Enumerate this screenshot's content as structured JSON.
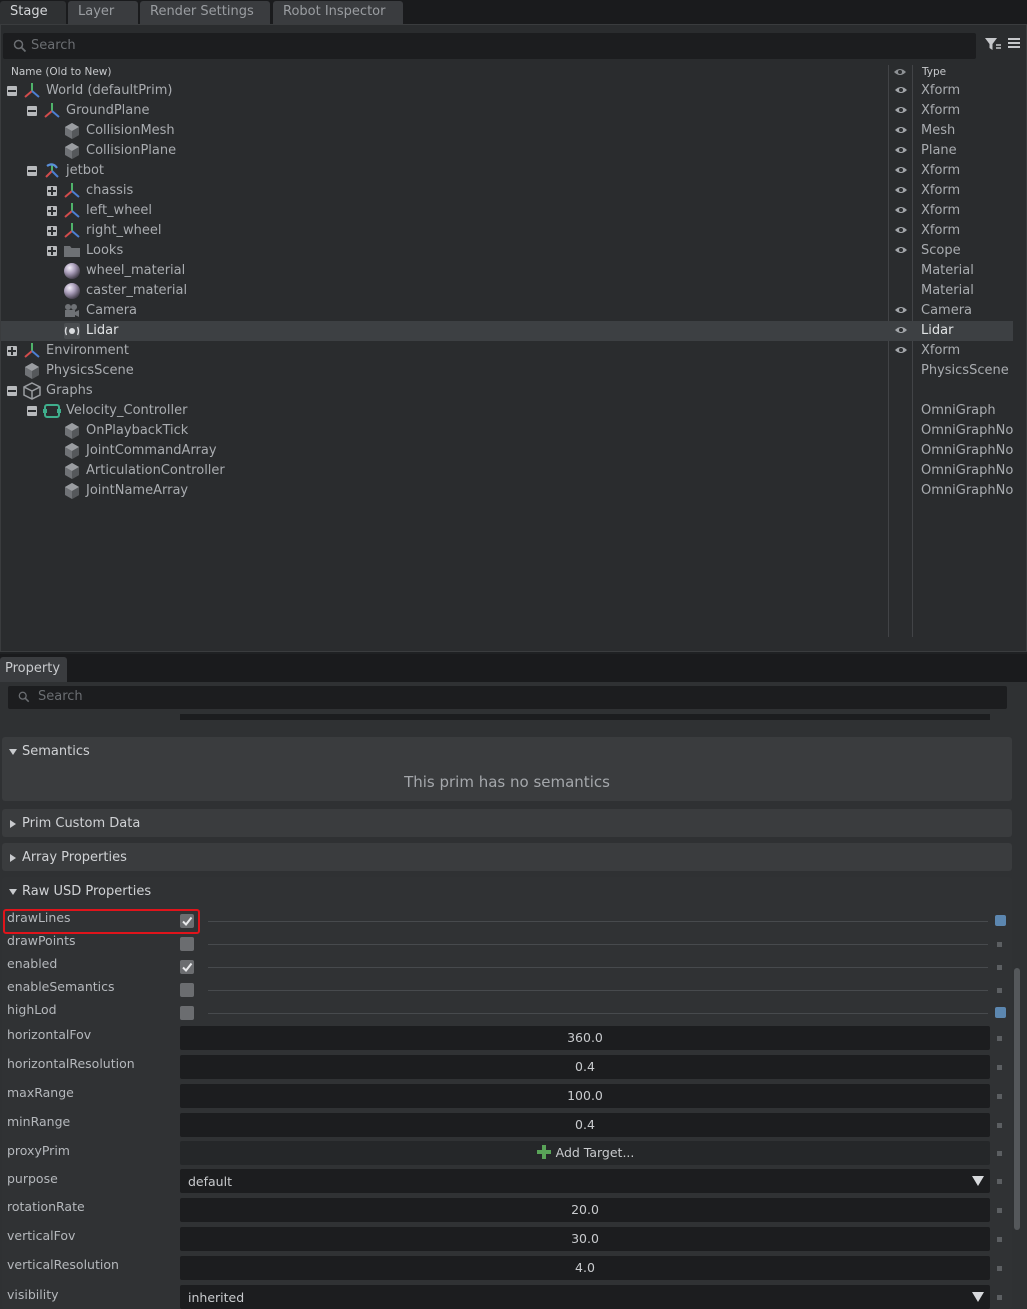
{
  "stage_tabs": [
    {
      "label": "Stage"
    },
    {
      "label": "Layer"
    },
    {
      "label": "Render Settings"
    },
    {
      "label": "Robot Inspector"
    }
  ],
  "stage": {
    "search_placeholder": "Search",
    "col_name": "Name (Old to New)",
    "col_type": "Type",
    "rows": [
      {
        "label": "World (defaultPrim)",
        "type": "Xform",
        "icon": "xform-icon"
      },
      {
        "label": "GroundPlane",
        "type": "Xform",
        "icon": "xform-icon"
      },
      {
        "label": "CollisionMesh",
        "type": "Mesh",
        "icon": "mesh-cube-icon"
      },
      {
        "label": "CollisionPlane",
        "type": "Plane",
        "icon": "mesh-cube-icon"
      },
      {
        "label": "jetbot",
        "type": "Xform",
        "icon": "robot-xform-icon"
      },
      {
        "label": "chassis",
        "type": "Xform",
        "icon": "xform-icon"
      },
      {
        "label": "left_wheel",
        "type": "Xform",
        "icon": "xform-icon"
      },
      {
        "label": "right_wheel",
        "type": "Xform",
        "icon": "xform-icon"
      },
      {
        "label": "Looks",
        "type": "Scope",
        "icon": "folder-icon"
      },
      {
        "label": "wheel_material",
        "type": "Material",
        "icon": "material-sphere-icon"
      },
      {
        "label": "caster_material",
        "type": "Material",
        "icon": "material-sphere-icon"
      },
      {
        "label": "Camera",
        "type": "Camera",
        "icon": "camera-icon"
      },
      {
        "label": "Lidar",
        "type": "Lidar",
        "icon": "lidar-icon"
      },
      {
        "label": "Environment",
        "type": "Xform",
        "icon": "xform-icon"
      },
      {
        "label": "PhysicsScene",
        "type": "PhysicsScene",
        "icon": "mesh-cube-icon"
      },
      {
        "label": "Graphs",
        "type": "",
        "icon": "graph-scope-icon"
      },
      {
        "label": "Velocity_Controller",
        "type": "OmniGraph",
        "icon": "omnigraph-icon"
      },
      {
        "label": "OnPlaybackTick",
        "type": "OmniGraphNode",
        "icon": "mesh-cube-icon"
      },
      {
        "label": "JointCommandArray",
        "type": "OmniGraphNode",
        "icon": "mesh-cube-icon"
      },
      {
        "label": "ArticulationController",
        "type": "OmniGraphNode",
        "icon": "mesh-cube-icon"
      },
      {
        "label": "JointNameArray",
        "type": "OmniGraphNode",
        "icon": "mesh-cube-icon"
      }
    ]
  },
  "property": {
    "tab_label": "Property",
    "search_placeholder": "Search",
    "sections": {
      "semantics": "Semantics",
      "no_semantics": "This prim has no semantics",
      "custom_data": "Prim Custom Data",
      "array_props": "Array Properties",
      "raw_usd": "Raw USD Properties"
    },
    "props": {
      "drawLines": {
        "label": "drawLines",
        "checked": true
      },
      "drawPoints": {
        "label": "drawPoints",
        "checked": false
      },
      "enabled": {
        "label": "enabled",
        "checked": true
      },
      "enableSemantics": {
        "label": "enableSemantics",
        "checked": false
      },
      "highLod": {
        "label": "highLod",
        "checked": false
      },
      "horizontalFov": {
        "label": "horizontalFov",
        "value": "360.0"
      },
      "horizontalResolution": {
        "label": "horizontalResolution",
        "value": "0.4"
      },
      "maxRange": {
        "label": "maxRange",
        "value": "100.0"
      },
      "minRange": {
        "label": "minRange",
        "value": "0.4"
      },
      "proxyPrim": {
        "label": "proxyPrim",
        "value": "Add Target..."
      },
      "purpose": {
        "label": "purpose",
        "value": "default"
      },
      "rotationRate": {
        "label": "rotationRate",
        "value": "20.0"
      },
      "verticalFov": {
        "label": "verticalFov",
        "value": "30.0"
      },
      "verticalResolution": {
        "label": "verticalResolution",
        "value": "4.0"
      },
      "visibility": {
        "label": "visibility",
        "value": "inherited"
      }
    }
  },
  "colors": {
    "selection_highlight": "#e0141b",
    "accent_blue": "#5c87b0"
  }
}
